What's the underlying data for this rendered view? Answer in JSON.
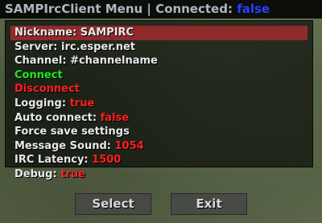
{
  "title": {
    "app_name": "SAMPIrcClient Menu",
    "separator": " | ",
    "status_label": "Connected: ",
    "status_value": "false"
  },
  "menu": {
    "items": [
      {
        "label": "Nickname: SAMPIRC",
        "value": ""
      },
      {
        "label": "Server: irc.esper.net",
        "value": ""
      },
      {
        "label": "Channel: #channelname",
        "value": ""
      },
      {
        "label": "Connect",
        "value": ""
      },
      {
        "label": "Disconnect",
        "value": ""
      },
      {
        "label": "Logging: ",
        "value": "true"
      },
      {
        "label": "Auto connect: ",
        "value": "false"
      },
      {
        "label": "Force save settings",
        "value": ""
      },
      {
        "label": "Message Sound: ",
        "value": "1054"
      },
      {
        "label": "IRC Latency: ",
        "value": "1500"
      },
      {
        "label": "Debug: ",
        "value": "true"
      }
    ],
    "selected_index": 0
  },
  "buttons": {
    "select_label": "Select",
    "exit_label": "Exit"
  },
  "colors": {
    "selection": "#8f2a2a",
    "value_red": "#ff2020",
    "connect_green": "#20e820",
    "status_blue": "#2a3fff"
  }
}
